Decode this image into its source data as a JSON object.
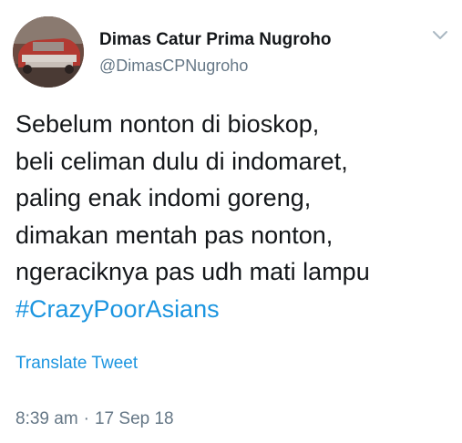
{
  "author": {
    "name": "Dimas Catur Prima Nugroho",
    "handle": "@DimasCPNugroho",
    "avatar_icon": "avatar-photo-red-car"
  },
  "menu": {
    "icon": "chevron-down-icon"
  },
  "tweet": {
    "lines": [
      "Sebelum nonton di bioskop,",
      "beli celiman dulu di indomaret,",
      "paling enak indomi goreng,",
      "dimakan mentah pas nonton,",
      "ngeraciknya pas udh mati lampu"
    ],
    "hashtag": "#CrazyPoorAsians"
  },
  "translate_label": "Translate Tweet",
  "meta": {
    "time": "8:39 am",
    "separator": "·",
    "date": "17 Sep 18"
  },
  "colors": {
    "text": "#14171a",
    "secondary": "#657786",
    "link": "#1b95e0"
  }
}
